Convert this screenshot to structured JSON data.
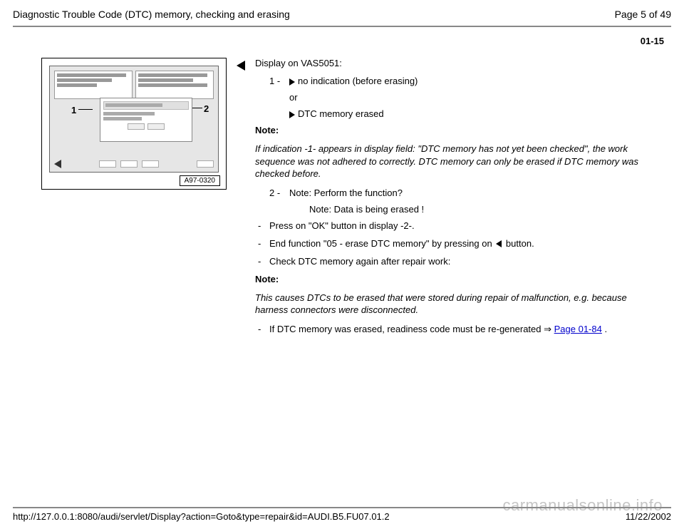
{
  "header": {
    "title": "Diagnostic Trouble Code (DTC) memory, checking and erasing",
    "page_label": "Page 5 of 49"
  },
  "section_number": "01-15",
  "figure": {
    "callout_1": "1",
    "callout_2": "2",
    "label": "A97-0320"
  },
  "body": {
    "display_heading": "Display on VAS5051:",
    "item1": {
      "num": "1 -",
      "line_a": "no indication (before erasing)",
      "or": "or",
      "line_b": "DTC memory erased"
    },
    "note1_heading": "Note:",
    "note1_body": "If indication -1- appears in display field: \"DTC memory has not yet been checked\", the work sequence was not adhered to correctly. DTC memory can only be erased if DTC memory was checked before.",
    "item2": {
      "num": "2 -",
      "text": "Note: Perform the function?",
      "sub": "Note: Data is being erased !"
    },
    "dash_a": "Press on \"OK\" button in display -2-.",
    "dash_b_pre": "End function \"05 - erase DTC memory\" by pressing on ",
    "dash_b_post": " button.",
    "dash_c": "Check DTC memory again after repair work:",
    "note2_heading": "Note:",
    "note2_body": "This causes DTCs to be erased that were stored during repair of malfunction, e.g. because harness connectors were disconnected.",
    "dash_d_pre": "If DTC memory was erased, readiness code must be re-generated  ⇒ ",
    "dash_d_link": "Page 01-84",
    "dash_d_post": " ."
  },
  "footer": {
    "url": "http://127.0.0.1:8080/audi/servlet/Display?action=Goto&type=repair&id=AUDI.B5.FU07.01.2",
    "date": "11/22/2002"
  },
  "watermark": "carmanualsonline.info"
}
